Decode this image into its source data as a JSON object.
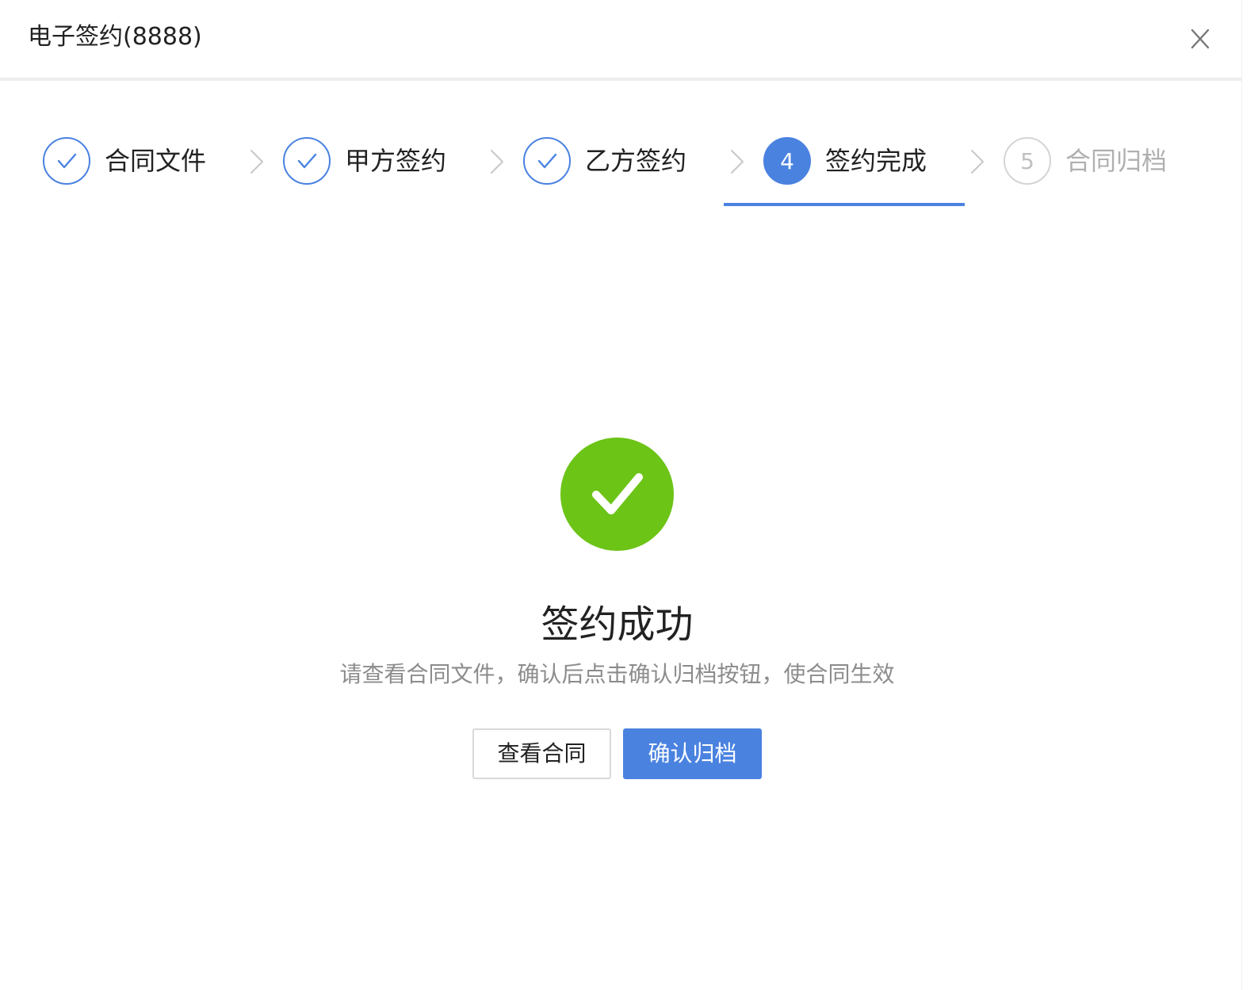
{
  "dialog": {
    "title": "电子签约(8888)",
    "close_icon": "close-icon"
  },
  "steps": [
    {
      "label": "合同文件",
      "status": "done",
      "icon": "check-icon"
    },
    {
      "label": "甲方签约",
      "status": "done",
      "icon": "check-icon"
    },
    {
      "label": "乙方签约",
      "status": "done",
      "icon": "check-icon"
    },
    {
      "label": "签约完成",
      "status": "active",
      "number": "4"
    },
    {
      "label": "合同归档",
      "status": "pending",
      "number": "5"
    }
  ],
  "result": {
    "icon": "success-check-icon",
    "title": "签约成功",
    "description": "请查看合同文件，确认后点击确认归档按钮，使合同生效"
  },
  "actions": {
    "view_label": "查看合同",
    "confirm_label": "确认归档"
  },
  "colors": {
    "primary": "#4a82e0",
    "success": "#6cc417",
    "pending": "#c0c0c0",
    "text": "#222222",
    "muted": "#8c8c8c"
  }
}
